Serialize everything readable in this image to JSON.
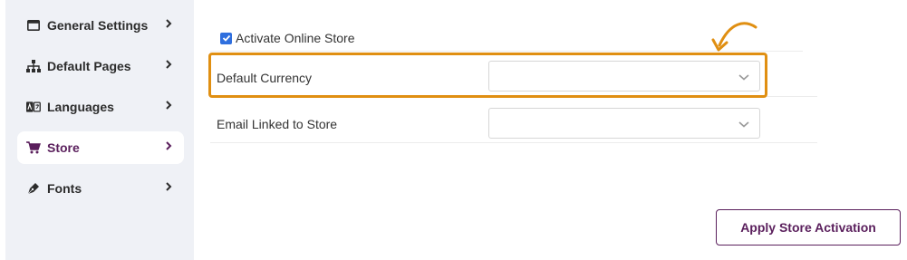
{
  "sidebar": {
    "items": [
      {
        "label": "General Settings",
        "icon": "window-icon",
        "active": false
      },
      {
        "label": "Default Pages",
        "icon": "sitemap-icon",
        "active": false
      },
      {
        "label": "Languages",
        "icon": "language-icon",
        "active": false
      },
      {
        "label": "Store",
        "icon": "cart-icon",
        "active": true
      },
      {
        "label": "Fonts",
        "icon": "pen-icon",
        "active": false
      }
    ]
  },
  "form": {
    "activate_label": "Activate Online Store",
    "activate_checked": true,
    "currency_label": "Default Currency",
    "currency_value": "",
    "email_label": "Email Linked to Store",
    "email_value": ""
  },
  "actions": {
    "apply_label": "Apply Store Activation"
  },
  "colors": {
    "accent": "#5a1f5c",
    "highlight": "#e08f12",
    "checkbox": "#2f6fde",
    "sidebar_bg": "#eff1f6"
  }
}
